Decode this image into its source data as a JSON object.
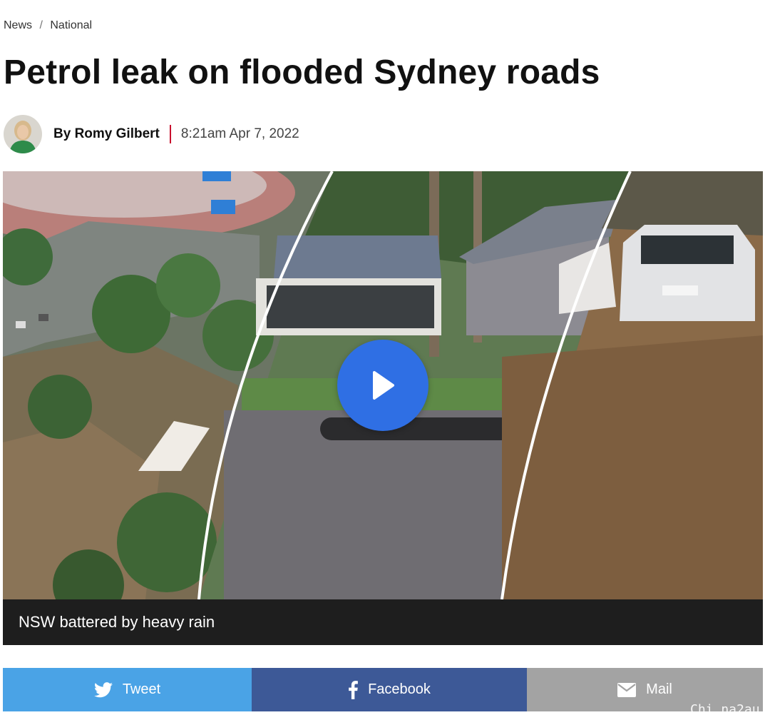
{
  "breadcrumb": {
    "items": [
      "News",
      "National"
    ],
    "separator": "/"
  },
  "article": {
    "title": "Petrol leak on flooded Sydney roads",
    "author": "By Romy Gilbert",
    "timestamp": "8:21am Apr 7, 2022"
  },
  "video": {
    "caption": "NSW battered by heavy rain",
    "play_icon": "play-icon"
  },
  "share": {
    "tweet_label": "Tweet",
    "facebook_label": "Facebook",
    "mail_label": "Mail",
    "tweet_color": "#4aa3e6",
    "facebook_color": "#3d5997",
    "mail_color": "#a3a3a3"
  },
  "watermark": "Chi na2au",
  "colors": {
    "accent_divider": "#c8102e",
    "play_button": "#2f6fe4",
    "caption_bar": "#1e1e1e"
  }
}
